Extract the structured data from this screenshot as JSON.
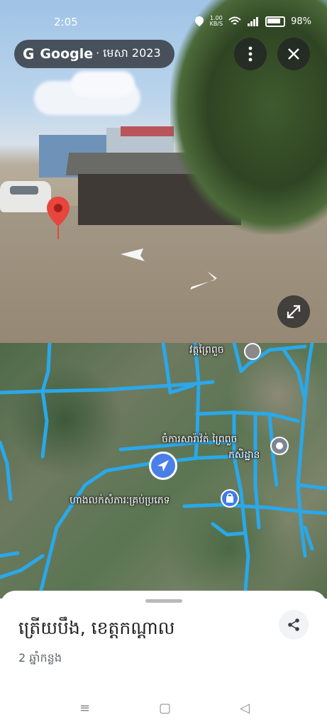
{
  "status_bar": {
    "time": "2:05",
    "speed": "1.00",
    "speed_unit": "KB/S",
    "battery": "98%"
  },
  "street_view": {
    "brand": "Google",
    "date": "· មេសា 2023",
    "more_icon": "more-vert-icon",
    "close_icon": "close-icon",
    "fullscreen_icon": "expand-icon"
  },
  "map": {
    "labels": {
      "pagoda": "វត្តព្រៃពួច",
      "market_line1": "ចំការសារ៉ាវ៉ត់ ព្រៃពួច",
      "market_line2": "កសិដ្ឋាន",
      "shop": "ហាងលក់សំភារៈគ្រប់ប្រភេទ"
    }
  },
  "sheet": {
    "title": "ត្រើយបឹង, ខេត្តកណ្តាល",
    "subtitle": "2 ឆ្នាំកន្លង"
  },
  "nav": {
    "menu_icon": "≡",
    "home_icon": "▢",
    "back_icon": "◁"
  }
}
